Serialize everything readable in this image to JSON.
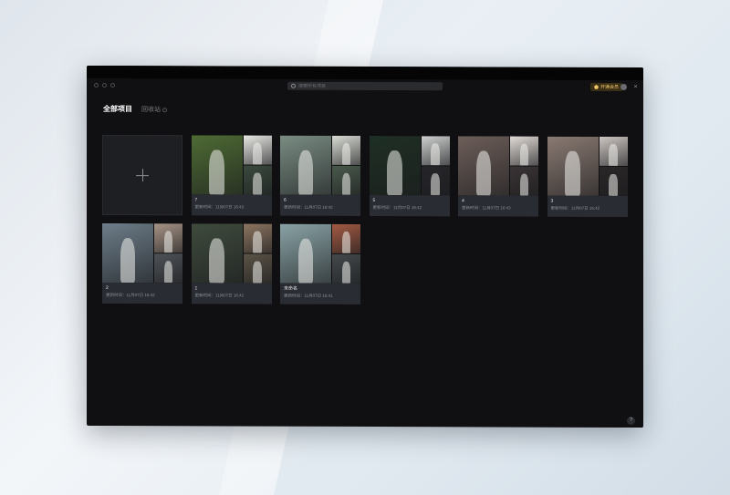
{
  "search": {
    "placeholder": "搜索所有项目"
  },
  "header": {
    "vip_label": "开通会员"
  },
  "tabs": {
    "all": "全部项目",
    "trash": "回收站"
  },
  "create_card": {
    "label": "+"
  },
  "projects": [
    {
      "name": "7",
      "time": "更新时间：11月07日 16:43",
      "tones": [
        "#4e6b34",
        "#e8e8e4",
        "#3b4a3e"
      ]
    },
    {
      "name": "6",
      "time": "更新时间：11月07日 16:42",
      "tones": [
        "#7a8d83",
        "#d9dcd4",
        "#4a5a4c"
      ]
    },
    {
      "name": "5",
      "time": "更新时间：11月07日 16:42",
      "tones": [
        "#1f2f24",
        "#cfd1d0",
        "#26262a"
      ]
    },
    {
      "name": "4",
      "time": "更新时间：11月07日 16:43",
      "tones": [
        "#6d5e59",
        "#e1dbd6",
        "#3a3335"
      ]
    },
    {
      "name": "3",
      "time": "更新时间：11月07日 16:42",
      "tones": [
        "#8a7a72",
        "#cdc6c2",
        "#2b2728"
      ]
    },
    {
      "name": "2",
      "time": "更新时间：11月07日 16:42",
      "tones": [
        "#6d7d89",
        "#a89486",
        "#4f5358"
      ]
    },
    {
      "name": "1",
      "time": "更新时间：11月07日 16:42",
      "tones": [
        "#3f4b3d",
        "#8c7560",
        "#5b5346"
      ]
    },
    {
      "name": "未命名",
      "time": "更新时间：11月07日 16:41",
      "tones": [
        "#8aa3a6",
        "#a35a43",
        "#44494c"
      ]
    }
  ],
  "help": {
    "label": "?"
  }
}
